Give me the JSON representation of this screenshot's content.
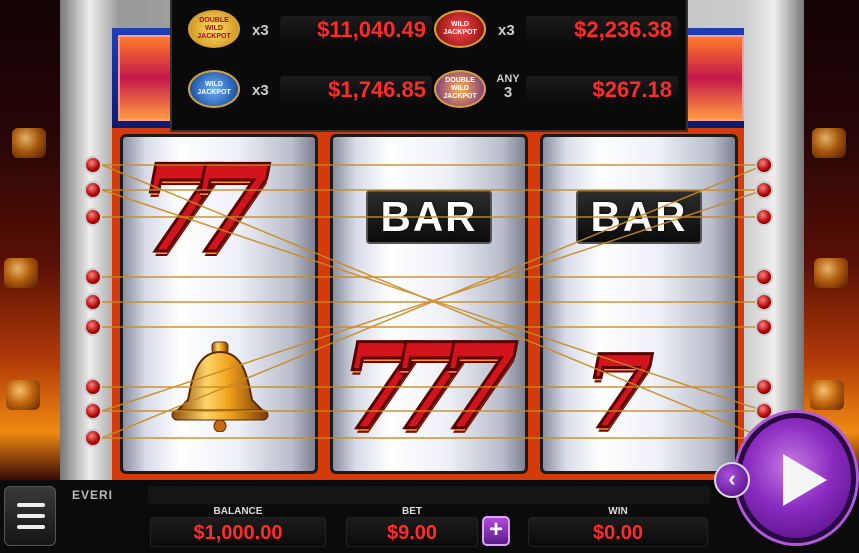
{
  "jackpots": [
    {
      "badge": "DOUBLE WILD JACKPOT",
      "multiplier": "x3",
      "amount": "$11,040.49"
    },
    {
      "badge": "WILD JACKPOT",
      "multiplier": "x3",
      "amount": "$2,236.38"
    },
    {
      "badge": "WILD JACKPOT",
      "multiplier": "x3",
      "amount": "$1,746.85"
    },
    {
      "badge": "DOUBLE WILD JACKPOT",
      "multiplier_top": "ANY",
      "multiplier_bottom": "3",
      "amount": "$267.18"
    }
  ],
  "reels": [
    [
      "seven",
      "bell"
    ],
    [
      "bar",
      "seven"
    ],
    [
      "bar",
      "seven"
    ]
  ],
  "symbols": {
    "bar": "BAR",
    "seven": "7"
  },
  "brand": "EVERI",
  "meters": {
    "balance_label": "BALANCE",
    "balance": "$1,000.00",
    "bet_label": "BET",
    "bet": "$9.00",
    "win_label": "WIN",
    "win": "$0.00"
  },
  "controls": {
    "plus": "+",
    "back": "‹"
  },
  "colors": {
    "accent": "#8a2cc0",
    "value_red": "#ff2a2a",
    "reel_border": "#d43a0a"
  }
}
